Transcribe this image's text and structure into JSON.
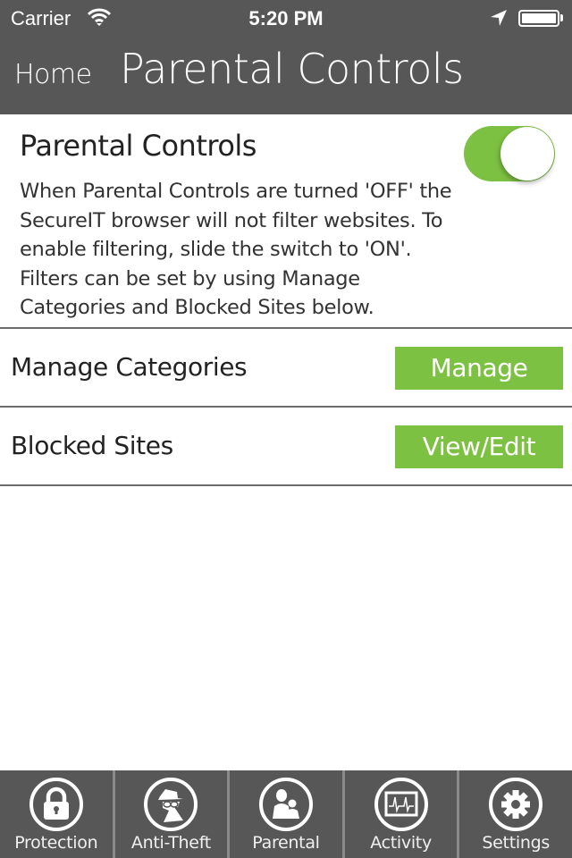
{
  "status_bar": {
    "carrier": "Carrier",
    "time": "5:20 PM",
    "icons": [
      "wifi-icon",
      "location-arrow-icon",
      "battery-icon"
    ],
    "battery_level": 1.0
  },
  "nav": {
    "back_label": "Home",
    "title": "Parental Controls"
  },
  "parental_controls": {
    "title": "Parental Controls",
    "description": "When Parental Controls are turned 'OFF' the SecureIT browser will not filter websites. To enable filtering, slide the switch to 'ON'. Filters can be set by using Manage Categories and Blocked Sites below.",
    "toggle_on": true,
    "accent_color": "#7dc142"
  },
  "rows": [
    {
      "label": "Manage Categories",
      "button_label": "Manage"
    },
    {
      "label": "Blocked Sites",
      "button_label": "View/Edit"
    }
  ],
  "tabbar": {
    "tabs": [
      {
        "label": "Protection",
        "icon": "lock-icon"
      },
      {
        "label": "Anti-Theft",
        "icon": "spy-icon"
      },
      {
        "label": "Parental",
        "icon": "parent-child-icon"
      },
      {
        "label": "Activity",
        "icon": "heartbeat-monitor-icon"
      },
      {
        "label": "Settings",
        "icon": "gear-icon"
      }
    ]
  },
  "colors": {
    "header_bg": "#575757",
    "accent": "#7dc142",
    "divider": "#6a6a6a"
  }
}
